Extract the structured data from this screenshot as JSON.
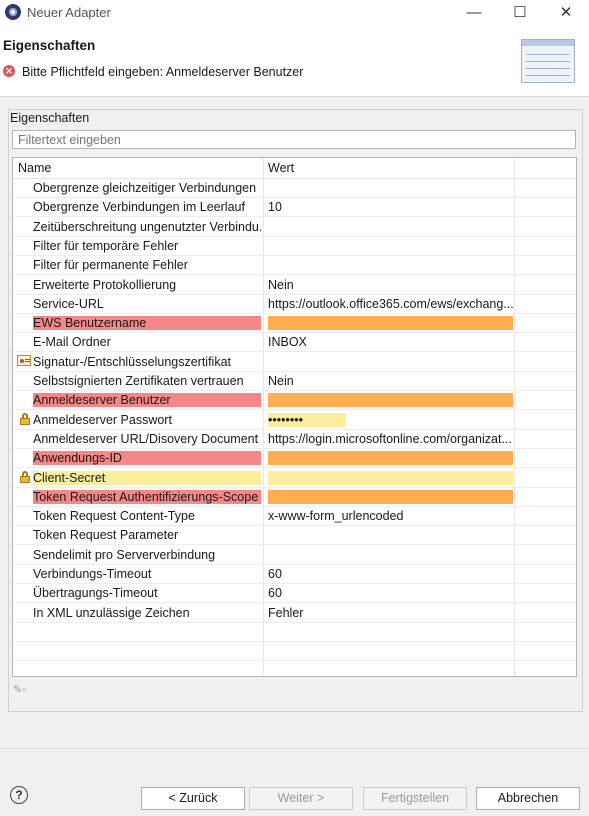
{
  "window": {
    "title": "Neuer Adapter",
    "minimize": "—",
    "maximize": "☐",
    "close": "✕"
  },
  "header": {
    "title": "Eigenschaften",
    "error_message": "Bitte Pflichtfeld eingeben: Anmeldeserver Benutzer"
  },
  "group": {
    "label": "Eigenschaften",
    "filter_placeholder": "Filtertext eingeben"
  },
  "table": {
    "columns": [
      "Name",
      "Wert"
    ],
    "rows": [
      {
        "name": "Obergrenze gleichzeitiger Verbindungen",
        "value": ""
      },
      {
        "name": "Obergrenze Verbindungen im Leerlauf",
        "value": "10"
      },
      {
        "name": "Zeitüberschreitung ungenutzter Verbindu...",
        "value": ""
      },
      {
        "name": "Filter für temporäre Fehler",
        "value": ""
      },
      {
        "name": "Filter für permanente Fehler",
        "value": ""
      },
      {
        "name": "Erweiterte Protokollierung",
        "value": "Nein"
      },
      {
        "name": "Service-URL",
        "value": "https://outlook.office365.com/ews/exchang..."
      },
      {
        "name": "EWS Benutzername",
        "value": ""
      },
      {
        "name": "E-Mail Ordner",
        "value": "INBOX"
      },
      {
        "name": "Signatur-/Entschlüsselungszertifikat",
        "value": ""
      },
      {
        "name": "Selbstsignierten Zertifikaten vertrauen",
        "value": "Nein"
      },
      {
        "name": "Anmeldeserver Benutzer",
        "value": ""
      },
      {
        "name": "Anmeldeserver Passwort",
        "value": "••••••••"
      },
      {
        "name": "Anmeldeserver URL/Disovery Document ...",
        "value": "https://login.microsoftonline.com/organizat..."
      },
      {
        "name": "Anwendungs-ID",
        "value": ""
      },
      {
        "name": "Client-Secret",
        "value": ""
      },
      {
        "name": "Token Request Authentifizierungs-Scope",
        "value": ""
      },
      {
        "name": "Token Request Content-Type",
        "value": "x-www-form_urlencoded"
      },
      {
        "name": "Token Request Parameter",
        "value": ""
      },
      {
        "name": "Sendelimit pro Serververbindung",
        "value": ""
      },
      {
        "name": "Verbindungs-Timeout",
        "value": "60"
      },
      {
        "name": "Übertragungs-Timeout",
        "value": "60"
      },
      {
        "name": "In XML unzulässige Zeichen",
        "value": "Fehler"
      }
    ]
  },
  "colors": {
    "required_missing": "#f58788",
    "highlight_orange": "#ffad4f",
    "highlight_yellow": "#fbee9e"
  },
  "buttons": {
    "help": "?",
    "back": "< Zurück",
    "next": "Weiter >",
    "finish": "Fertigstellen",
    "cancel": "Abbrechen"
  }
}
